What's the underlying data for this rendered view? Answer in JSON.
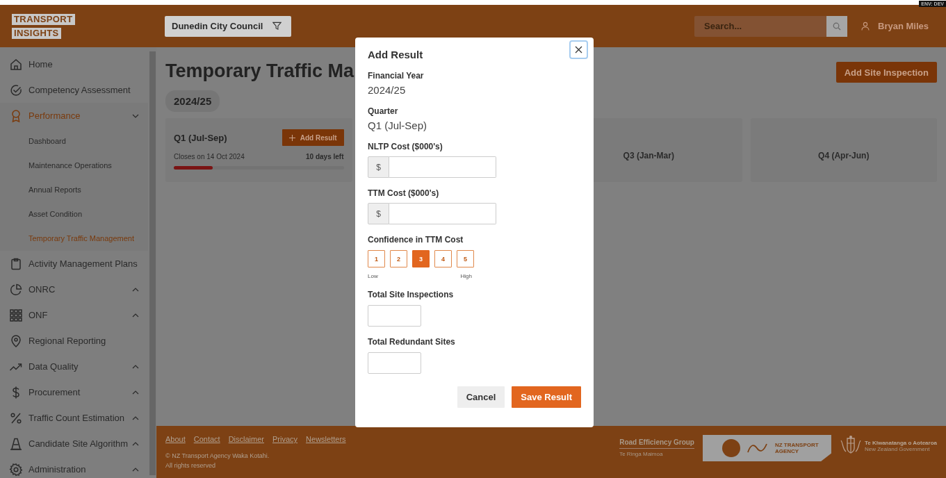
{
  "header": {
    "logo": [
      "TRANSPORT",
      "INSIGHTS"
    ],
    "organisation": "Dunedin City Council",
    "search": {
      "placeholder": "Search..."
    },
    "user": "Bryan Miles",
    "environment": "ENV: DEV"
  },
  "sidebar": {
    "items": [
      {
        "label": "Home",
        "selected": false
      },
      {
        "label": "Competency Assessment",
        "selected": false
      },
      {
        "label": "Performance",
        "selected": true,
        "expanded": true,
        "children": [
          {
            "label": "Dashboard",
            "selected": false
          },
          {
            "label": "Maintenance Operations",
            "selected": false
          },
          {
            "label": "Annual Reports",
            "selected": false
          },
          {
            "label": "Asset Condition",
            "selected": false
          },
          {
            "label": "Temporary Traffic Management",
            "selected": true
          }
        ]
      },
      {
        "label": "Activity Management Plans",
        "selected": false
      },
      {
        "label": "ONRC",
        "selected": false,
        "expanded": false
      },
      {
        "label": "ONF",
        "selected": false,
        "expanded": false
      },
      {
        "label": "Regional Reporting",
        "selected": false
      },
      {
        "label": "Data Quality",
        "selected": false,
        "expanded": false
      },
      {
        "label": "Procurement",
        "selected": false,
        "expanded": false
      },
      {
        "label": "Traffic Count Estimation",
        "selected": false,
        "expanded": false
      },
      {
        "label": "Candidate Site Algorithm",
        "selected": false,
        "expanded": false
      },
      {
        "label": "Administration",
        "selected": false,
        "expanded": false
      }
    ]
  },
  "page": {
    "title": "Temporary Traffic Ma",
    "year": "2024/25",
    "action": "Add Site Inspection",
    "quarters": [
      {
        "title": "Q1 (Jul-Sep)",
        "kind": "open",
        "button": "Add Result",
        "closes": "Closes on 14 Oct 2024",
        "remaining": "10 days left",
        "level": 0.23
      },
      {
        "title": "Q3 (Jan-Mar)",
        "kind": "future"
      },
      {
        "title": "Q4 (Apr-Jun)",
        "kind": "future"
      }
    ]
  },
  "footer": {
    "links": [
      "About",
      "Contact",
      "Disclaimer",
      "Privacy",
      "Newsletters"
    ],
    "copyright": [
      "© NZ Transport Agency Waka Kotahi.",
      "All rights reserved"
    ],
    "partner": {
      "name": "Road Efficiency Group",
      "subtitle": "Te Ringa Maimoa"
    },
    "agency": [
      "NZ TRANSPORT",
      "AGENCY"
    ],
    "government": [
      "Te Kīwanatanga o Aotearoa",
      "New Zealand Government"
    ]
  },
  "dialog": {
    "title": "Add Result",
    "fields": [
      {
        "kind": "readonly",
        "label": "Financial Year",
        "value": "2024/25"
      },
      {
        "kind": "readonly",
        "label": "Quarter",
        "value": "Q1 (Jul-Sep)"
      },
      {
        "kind": "currency",
        "label": "NLTP Cost ($000's)",
        "prefix": "$"
      },
      {
        "kind": "currency",
        "label": "TTM Cost ($000's)",
        "prefix": "$"
      },
      {
        "kind": "rating",
        "label": "Confidence in TTM Cost",
        "low": "Low",
        "high": "High",
        "options": [
          {
            "label": "1",
            "selected": false
          },
          {
            "label": "2",
            "selected": false
          },
          {
            "label": "3",
            "selected": true
          },
          {
            "label": "4",
            "selected": false
          },
          {
            "label": "5",
            "selected": false
          }
        ]
      },
      {
        "kind": "number",
        "label": "Total Site Inspections"
      },
      {
        "kind": "number",
        "label": "Total Redundant Sites"
      }
    ],
    "buttons": [
      {
        "label": "Cancel",
        "kind": "secondary"
      },
      {
        "label": "Save Result",
        "kind": "primary"
      }
    ]
  }
}
